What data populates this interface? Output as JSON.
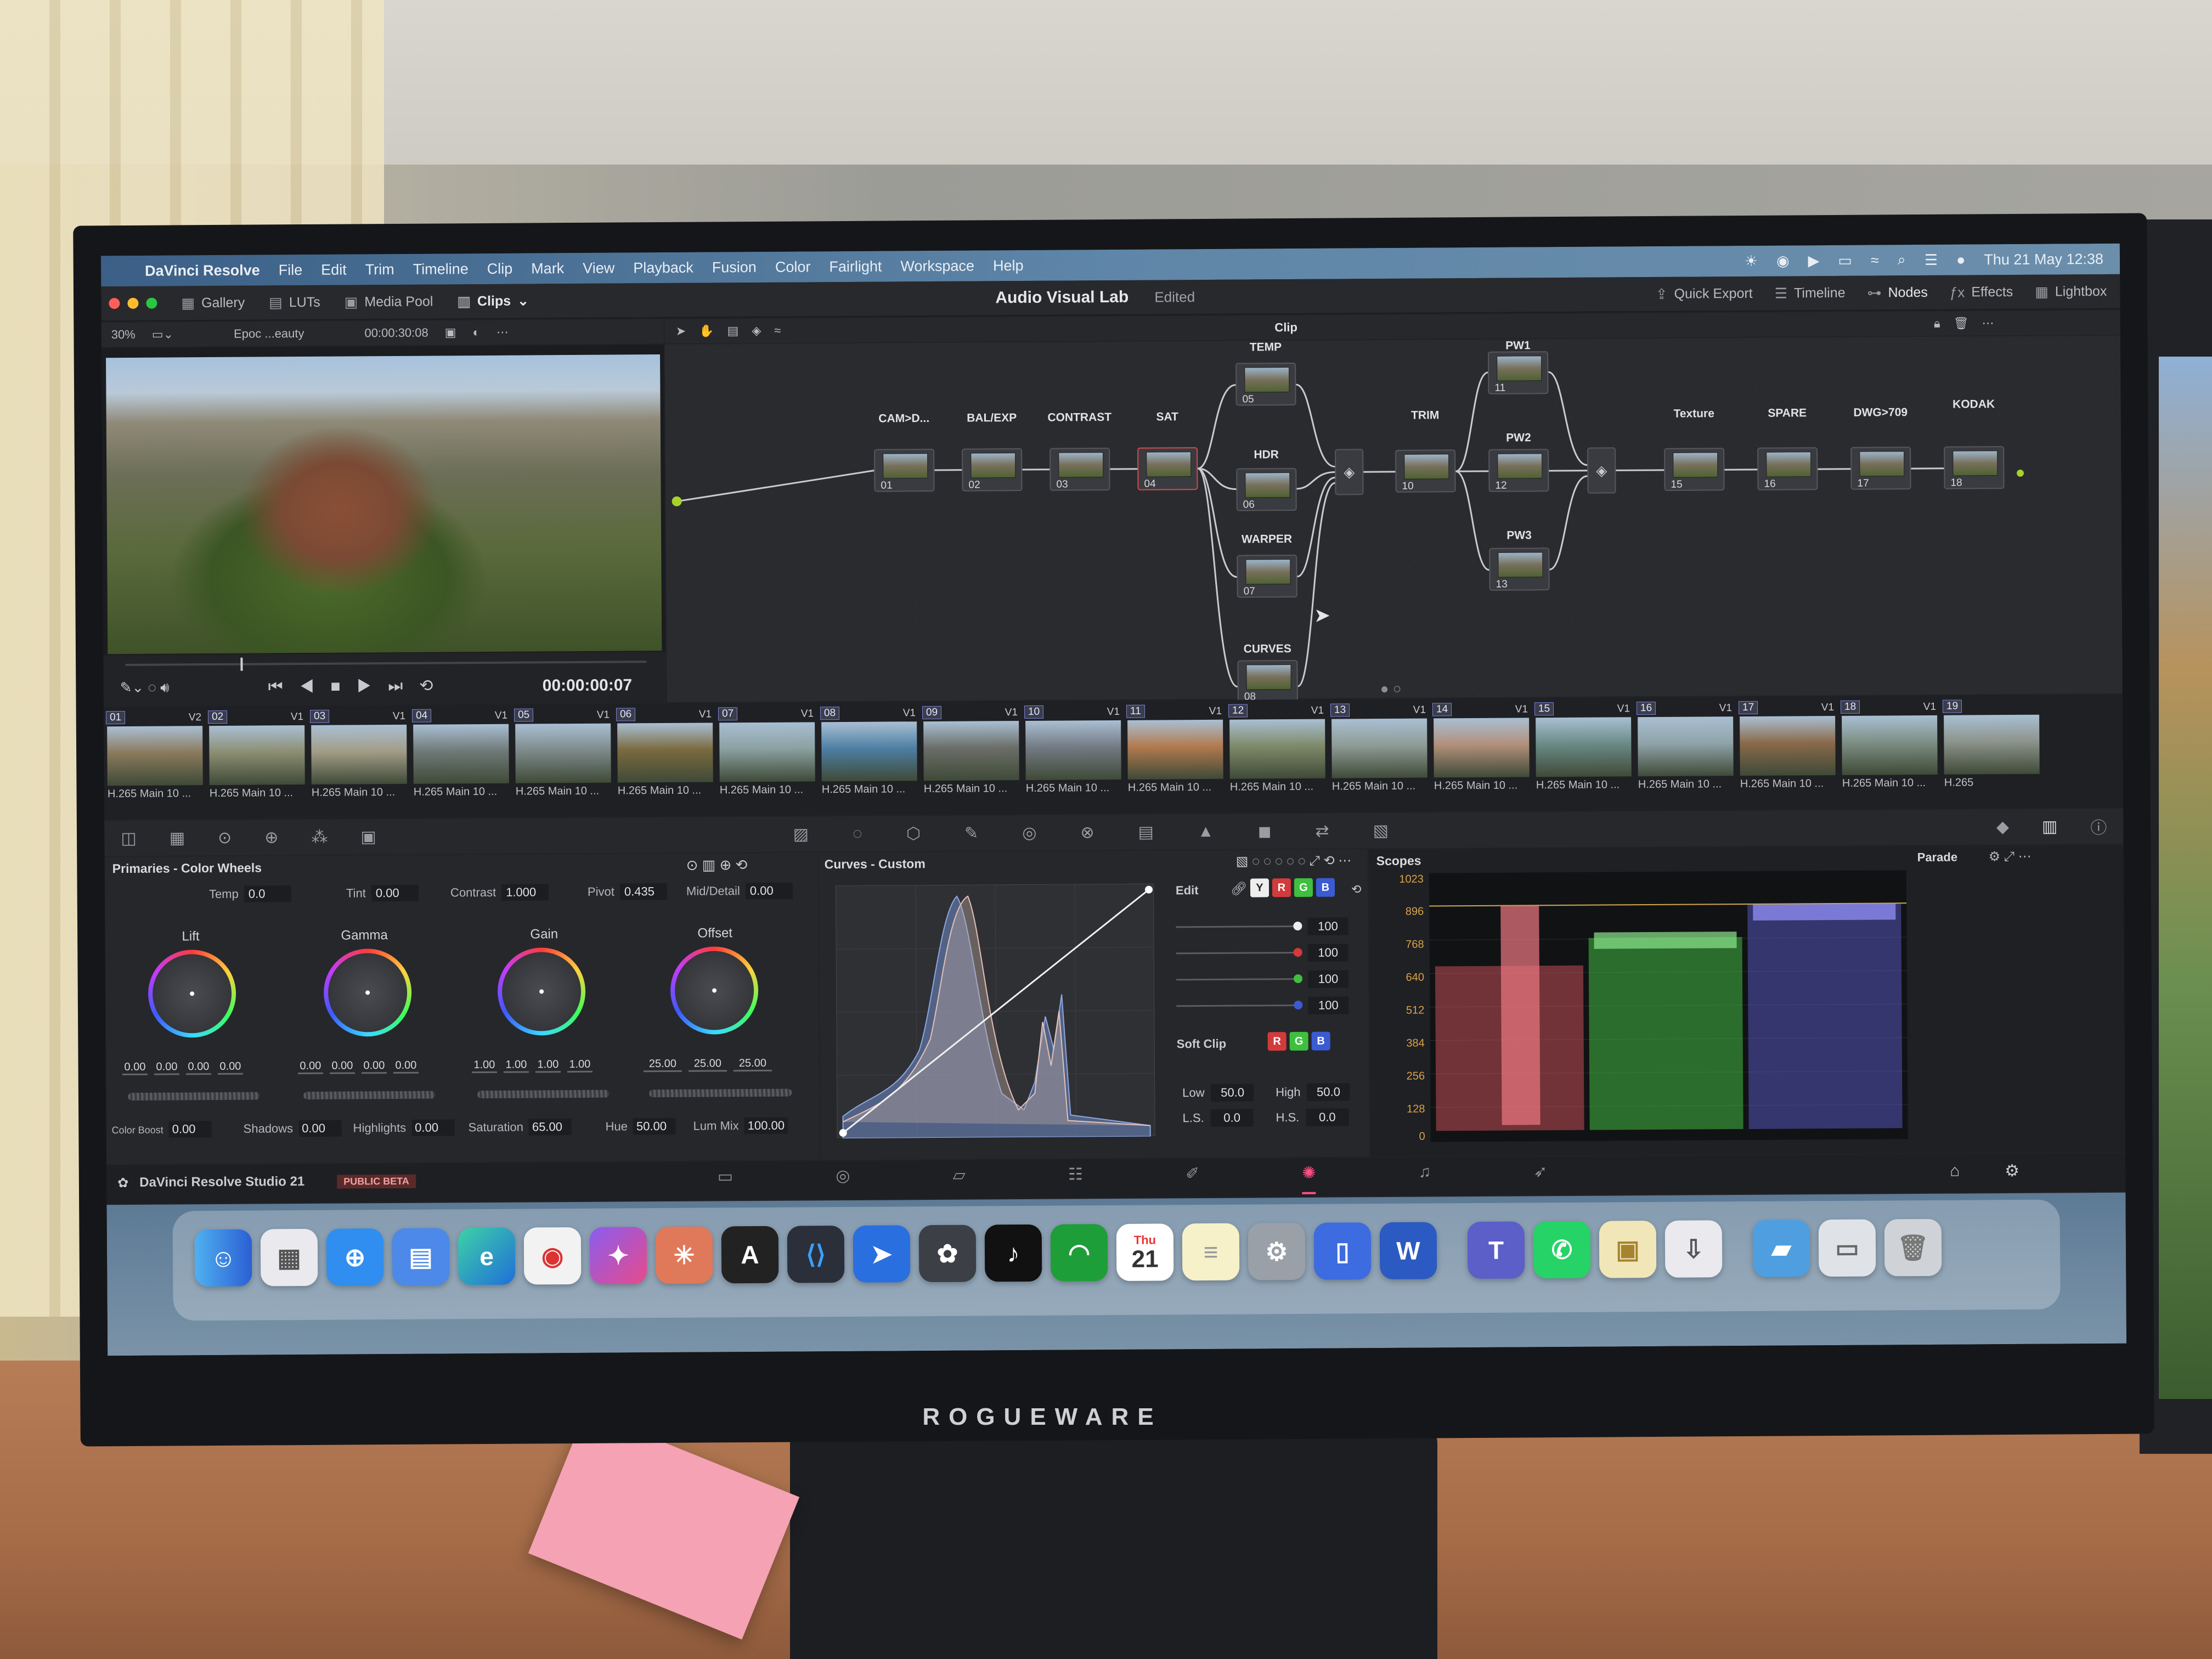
{
  "menubar": {
    "app": "DaVinci Resolve",
    "items": [
      "File",
      "Edit",
      "Trim",
      "Timeline",
      "Clip",
      "Mark",
      "View",
      "Playback",
      "Fusion",
      "Color",
      "Fairlight",
      "Workspace",
      "Help"
    ],
    "datetime": "Thu 21 May  12:38"
  },
  "topbar": {
    "gallery": "Gallery",
    "luts": "LUTs",
    "media_pool": "Media Pool",
    "clips": "Clips",
    "project_title": "Audio Visual Lab",
    "project_status": "Edited",
    "quick_export": "Quick Export",
    "timeline": "Timeline",
    "nodes": "Nodes",
    "effects": "Effects",
    "lightbox": "Lightbox"
  },
  "viewer": {
    "zoom": "30%",
    "clip_name": "Epoc ...eauty",
    "source_timecode": "00:00:30:08",
    "timecode": "00:00:00:07"
  },
  "node_toolbar": {
    "mode": "Clip"
  },
  "nodes": [
    {
      "label": "CAM>D...",
      "num": "01"
    },
    {
      "label": "BAL/EXP",
      "num": "02"
    },
    {
      "label": "CONTRAST",
      "num": "03"
    },
    {
      "label": "SAT",
      "num": "04"
    },
    {
      "label": "TEMP",
      "num": "05"
    },
    {
      "label": "HDR",
      "num": "06"
    },
    {
      "label": "WARPER",
      "num": "07"
    },
    {
      "label": "CURVES",
      "num": "08"
    },
    {
      "label": "TRIM",
      "num": "10"
    },
    {
      "label": "PW1",
      "num": "11"
    },
    {
      "label": "PW2",
      "num": "12"
    },
    {
      "label": "PW3",
      "num": "13"
    },
    {
      "label": "Texture",
      "num": "15"
    },
    {
      "label": "SPARE",
      "num": "16"
    },
    {
      "label": "DWG>709",
      "num": "17"
    },
    {
      "label": "KODAK",
      "num": "18"
    }
  ],
  "clips": [
    {
      "num": "01",
      "track": "V2",
      "caption": "H.265 Main 10 ...",
      "color": "#8a7a5c"
    },
    {
      "num": "02",
      "track": "V1",
      "caption": "H.265 Main 10 ...",
      "color": "#8c8e72"
    },
    {
      "num": "03",
      "track": "V1",
      "caption": "H.265 Main 10 ...",
      "color": "#a29c86"
    },
    {
      "num": "04",
      "track": "V1",
      "caption": "H.265 Main 10 ...",
      "color": "#6f7a78"
    },
    {
      "num": "05",
      "track": "V1",
      "caption": "H.265 Main 10 ...",
      "color": "#7d8a8a"
    },
    {
      "num": "06",
      "track": "V1",
      "caption": "H.265 Main 10 ...",
      "color": "#7a6a3e"
    },
    {
      "num": "07",
      "track": "V1",
      "caption": "H.265 Main 10 ...",
      "color": "#8aa0a0"
    },
    {
      "num": "08",
      "track": "V1",
      "caption": "H.265 Main 10 ...",
      "color": "#4d7fa3"
    },
    {
      "num": "09",
      "track": "V1",
      "caption": "H.265 Main 10 ...",
      "color": "#6b6e68"
    },
    {
      "num": "10",
      "track": "V1",
      "caption": "H.265 Main 10 ...",
      "color": "#737a83"
    },
    {
      "num": "11",
      "track": "V1",
      "caption": "H.265 Main 10 ...",
      "color": "#b27a4e"
    },
    {
      "num": "12",
      "track": "V1",
      "caption": "H.265 Main 10 ...",
      "color": "#7f8a6a"
    },
    {
      "num": "13",
      "track": "V1",
      "caption": "H.265 Main 10 ...",
      "color": "#8e9c96"
    },
    {
      "num": "14",
      "track": "V1",
      "caption": "H.265 Main 10 ...",
      "color": "#b2907a"
    },
    {
      "num": "15",
      "track": "V1",
      "caption": "H.265 Main 10 ...",
      "color": "#6a8a86"
    },
    {
      "num": "16",
      "track": "V1",
      "caption": "H.265 Main 10 ...",
      "color": "#8fa3a8"
    },
    {
      "num": "17",
      "track": "V1",
      "caption": "H.265 Main 10 ...",
      "color": "#8a6a4a"
    },
    {
      "num": "18",
      "track": "V1",
      "caption": "H.265 Main 10 ...",
      "color": "#7d8f84"
    },
    {
      "num": "19",
      "track": "",
      "caption": "H.265",
      "color": "#8c948c"
    }
  ],
  "primaries": {
    "title": "Primaries - Color Wheels",
    "temp_label": "Temp",
    "temp": "0.0",
    "tint_label": "Tint",
    "tint": "0.00",
    "contrast_label": "Contrast",
    "contrast": "1.000",
    "pivot_label": "Pivot",
    "pivot": "0.435",
    "middetail_label": "Mid/Detail",
    "middetail": "0.00",
    "wheels": [
      {
        "name": "Lift",
        "values": [
          "0.00",
          "0.00",
          "0.00",
          "0.00"
        ]
      },
      {
        "name": "Gamma",
        "values": [
          "0.00",
          "0.00",
          "0.00",
          "0.00"
        ]
      },
      {
        "name": "Gain",
        "values": [
          "1.00",
          "1.00",
          "1.00",
          "1.00"
        ]
      },
      {
        "name": "Offset",
        "values": [
          "25.00",
          "25.00",
          "25.00"
        ]
      }
    ],
    "color_boost_label": "Color Boost",
    "color_boost": "0.00",
    "shadows_label": "Shadows",
    "shadows": "0.00",
    "highlights_label": "Highlights",
    "highlights": "0.00",
    "saturation_label": "Saturation",
    "saturation": "65.00",
    "hue_label": "Hue",
    "hue": "50.00",
    "lummix_label": "Lum Mix",
    "lummix": "100.00"
  },
  "curves": {
    "title": "Curves - Custom",
    "edit_label": "Edit",
    "channels": [
      "Y",
      "R",
      "G",
      "B"
    ],
    "channel_values": [
      "100",
      "100",
      "100",
      "100"
    ],
    "soft_clip_label": "Soft Clip",
    "low_label": "Low",
    "low": "50.0",
    "high_label": "High",
    "high": "50.0",
    "ls_label": "L.S.",
    "ls": "0.0",
    "hs_label": "H.S.",
    "hs": "0.0"
  },
  "scopes": {
    "title": "Scopes",
    "mode": "Parade",
    "ticks": [
      "1023",
      "896",
      "768",
      "640",
      "512",
      "384",
      "256",
      "128",
      "0"
    ]
  },
  "status": {
    "app_name": "DaVinci Resolve Studio 21",
    "beta": "PUBLIC BETA"
  },
  "dock": {
    "calendar_month": "Thu",
    "calendar_day": "21"
  },
  "monitor": {
    "brand": "ROGUEWARE"
  }
}
